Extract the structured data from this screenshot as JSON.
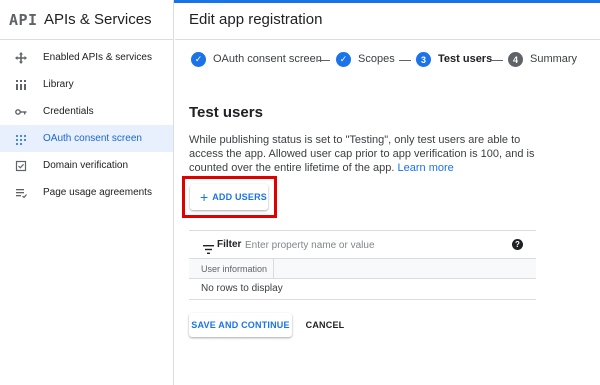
{
  "header": {
    "logo": "API",
    "app_title": "APIs & Services",
    "page_title": "Edit app registration"
  },
  "sidebar": {
    "items": [
      {
        "label": "Enabled APIs & services",
        "icon": "enabled-apis-icon",
        "active": false
      },
      {
        "label": "Library",
        "icon": "library-icon",
        "active": false
      },
      {
        "label": "Credentials",
        "icon": "key-icon",
        "active": false
      },
      {
        "label": "OAuth consent screen",
        "icon": "oauth-icon",
        "active": true
      },
      {
        "label": "Domain verification",
        "icon": "domain-check-icon",
        "active": false
      },
      {
        "label": "Page usage agreements",
        "icon": "agreements-icon",
        "active": false
      }
    ]
  },
  "stepper": {
    "steps": [
      {
        "label": "OAuth consent screen",
        "state": "done",
        "marker": "✓"
      },
      {
        "label": "Scopes",
        "state": "done",
        "marker": "✓"
      },
      {
        "label": "Test users",
        "state": "current",
        "marker": "3"
      },
      {
        "label": "Summary",
        "state": "pending",
        "marker": "4"
      }
    ]
  },
  "test_users": {
    "title": "Test users",
    "description": "While publishing status is set to \"Testing\", only test users are able to access the app. Allowed user cap prior to app verification is 100, and is counted over the entire lifetime of the app.",
    "learn_more": "Learn more",
    "add_button": "ADD USERS"
  },
  "filter": {
    "label": "Filter",
    "placeholder": "Enter property name or value",
    "help": "?"
  },
  "table": {
    "columns": [
      "User information"
    ],
    "empty_text": "No rows to display"
  },
  "actions": {
    "save_label": "SAVE AND CONTINUE",
    "cancel_label": "CANCEL"
  },
  "colors": {
    "accent": "#1a73e8",
    "active_bg": "#e8f0fe",
    "highlight": "#e00000"
  }
}
